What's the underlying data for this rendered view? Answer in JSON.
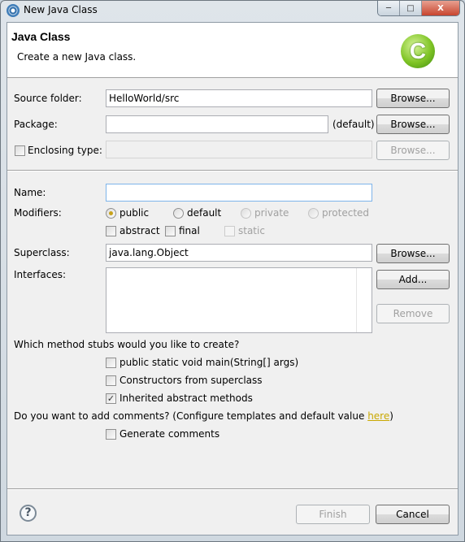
{
  "window": {
    "title": "New Java Class",
    "app_icon": "eclipse-icon",
    "controls": [
      "minimize",
      "maximize",
      "close"
    ]
  },
  "header": {
    "title": "Java Class",
    "description": "Create a new Java class.",
    "logo_icon": "java-class-icon",
    "logo_text": "C"
  },
  "source_folder": {
    "label": "Source folder:",
    "value": "HelloWorld/src",
    "browse": "Browse..."
  },
  "package": {
    "label": "Package:",
    "value": "",
    "hint": "(default)",
    "browse": "Browse..."
  },
  "enclosing": {
    "label": "Enclosing type:",
    "checked": false,
    "value": "",
    "browse": "Browse..."
  },
  "name": {
    "label": "Name:",
    "value": ""
  },
  "modifiers": {
    "label": "Modifiers:",
    "radios": [
      {
        "label": "public",
        "selected": true,
        "enabled": true
      },
      {
        "label": "default",
        "selected": false,
        "enabled": true
      },
      {
        "label": "private",
        "selected": false,
        "enabled": false
      },
      {
        "label": "protected",
        "selected": false,
        "enabled": false
      }
    ],
    "checks": [
      {
        "label": "abstract",
        "checked": false,
        "enabled": true
      },
      {
        "label": "final",
        "checked": false,
        "enabled": true
      },
      {
        "label": "static",
        "checked": false,
        "enabled": false
      }
    ]
  },
  "superclass": {
    "label": "Superclass:",
    "value": "java.lang.Object",
    "browse": "Browse..."
  },
  "interfaces": {
    "label": "Interfaces:",
    "items": [],
    "add": "Add...",
    "remove": "Remove"
  },
  "stubs": {
    "question": "Which method stubs would you like to create?",
    "options": [
      {
        "label": "public static void main(String[] args)",
        "checked": false
      },
      {
        "label": "Constructors from superclass",
        "checked": false
      },
      {
        "label": "Inherited abstract methods",
        "checked": true
      }
    ]
  },
  "comments": {
    "question_pre": "Do you want to add comments? (Configure templates and default value ",
    "link": "here",
    "question_post": ")",
    "option": "Generate comments",
    "checked": false
  },
  "footer": {
    "finish": "Finish",
    "cancel": "Cancel",
    "help_icon": "help-icon"
  },
  "colors": {
    "link": "#c9a800",
    "radio_selected": "#c8a21a",
    "logo": "#7fc425"
  }
}
